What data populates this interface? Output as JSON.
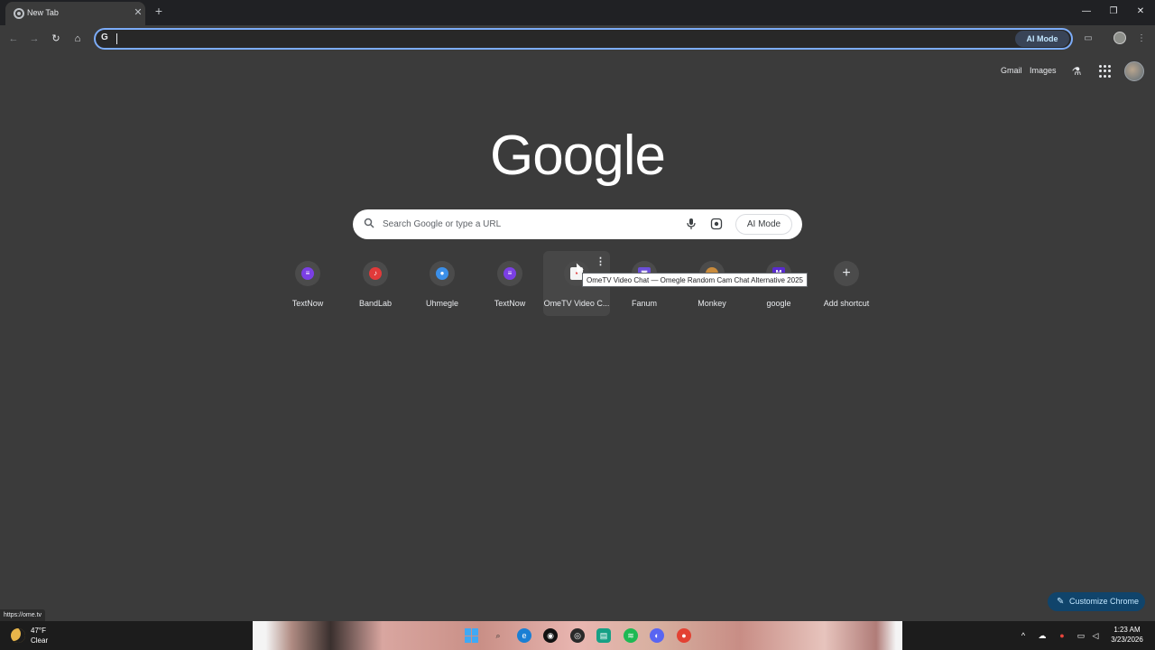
{
  "browser": {
    "tab": {
      "title": "New Tab"
    },
    "toolbar": {
      "omnibox_value": "",
      "omnibox_ai_mode": "AI Mode"
    }
  },
  "header": {
    "gmail": "Gmail",
    "images": "Images"
  },
  "logo": {
    "text": "Google"
  },
  "search": {
    "placeholder": "Search Google or type a URL",
    "ai_mode": "AI Mode"
  },
  "shortcuts": [
    {
      "label": "TextNow",
      "icon": "textnow-icon",
      "color": "#7b3fe4",
      "glyph": "💬"
    },
    {
      "label": "BandLab",
      "icon": "bandlab-icon",
      "color": "#e13a3a",
      "glyph": "♪"
    },
    {
      "label": "Uhmegle",
      "icon": "uhmegle-icon",
      "color": "#3b8fe8",
      "glyph": "●"
    },
    {
      "label": "TextNow",
      "icon": "textnow-icon",
      "color": "#7b3fe4",
      "glyph": "💬"
    },
    {
      "label": "OmeTV Video C...",
      "icon": "ometv-icon",
      "color": "#f4f4f4",
      "glyph": ""
    },
    {
      "label": "Fanum",
      "icon": "fanum-icon",
      "color": "#6b4fd8",
      "glyph": "▣"
    },
    {
      "label": "Monkey",
      "icon": "monkey-icon",
      "color": "#c98b3c",
      "glyph": "●"
    },
    {
      "label": "google",
      "icon": "google-icon",
      "color": "#5a2bd1",
      "glyph": "M"
    },
    {
      "label": "Add shortcut",
      "icon": "plus-icon"
    }
  ],
  "tooltip": "OmeTV Video Chat — Omegle Random Cam Chat Alternative 2025",
  "customize": {
    "label": "Customize Chrome"
  },
  "status_url": "https://ome.tv",
  "taskbar": {
    "weather_temp": "47°F",
    "weather_condition": "Clear",
    "time": "1:23 AM",
    "date": "3/23/2026"
  }
}
